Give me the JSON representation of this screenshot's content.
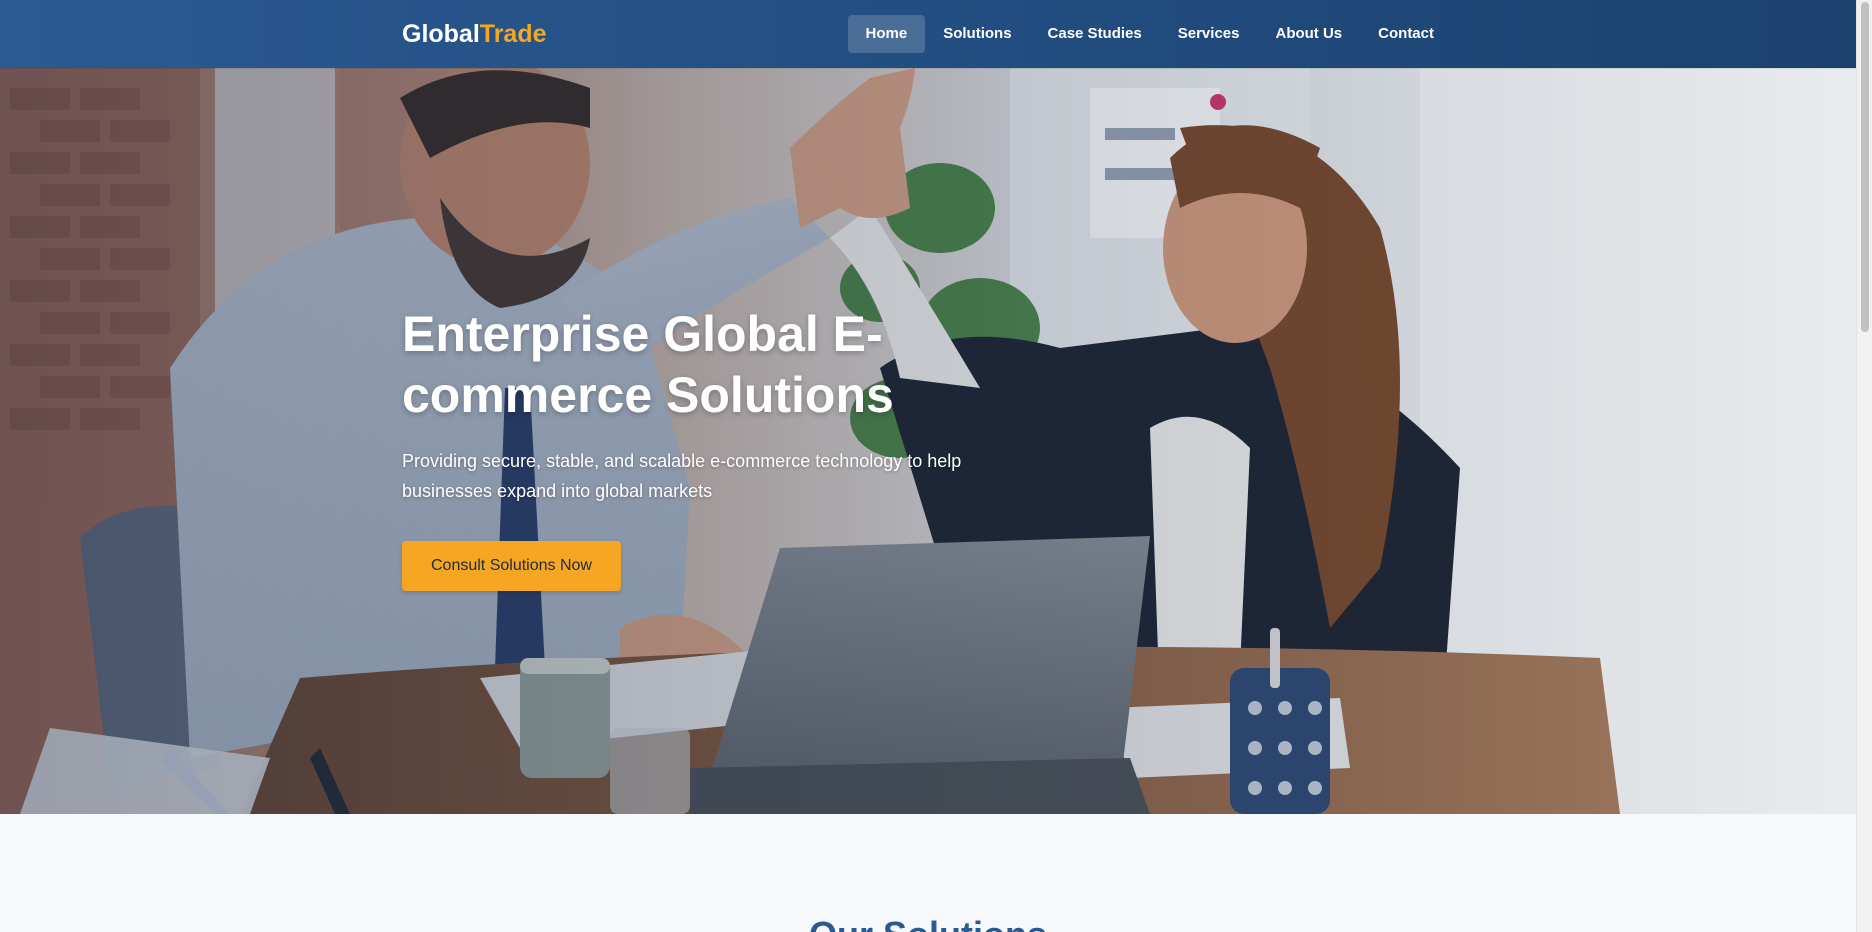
{
  "header": {
    "logo": {
      "part1": "Global",
      "part2": "Trade"
    },
    "nav": [
      {
        "label": "Home",
        "active": true
      },
      {
        "label": "Solutions",
        "active": false
      },
      {
        "label": "Case Studies",
        "active": false
      },
      {
        "label": "Services",
        "active": false
      },
      {
        "label": "About Us",
        "active": false
      },
      {
        "label": "Contact",
        "active": false
      }
    ]
  },
  "hero": {
    "title": "Enterprise Global E-commerce Solutions",
    "subtitle": "Providing secure, stable, and scalable e-commerce technology to help businesses expand into global markets",
    "cta_label": "Consult Solutions Now",
    "image_icon": "office-high-five-photo"
  },
  "solutions": {
    "title": "Our Solutions"
  },
  "colors": {
    "header_start": "#2a5a91",
    "header_end": "#1b426f",
    "accent": "#f5a623",
    "section_bg": "#f6f8fb",
    "section_title": "#2a5a91"
  }
}
